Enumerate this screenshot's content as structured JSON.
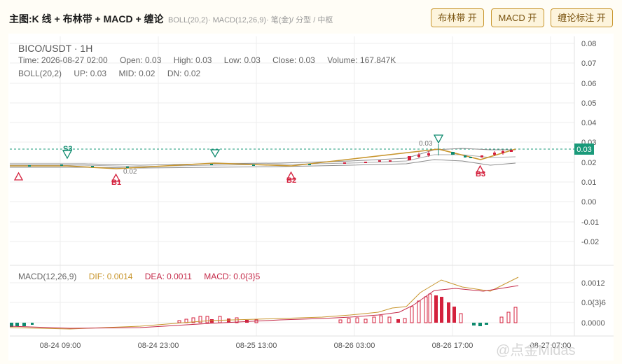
{
  "header": {
    "title": "主图:K 线 + 布林带 + MACD + 缠论",
    "subtitle": "BOLL(20,2)· MACD(12,26,9)· 笔(金)/ 分型 / 中枢",
    "buttons": {
      "boll": "布林带 开",
      "macd": "MACD 开",
      "chan": "缠论标注 开"
    }
  },
  "legend": {
    "symbol": "BICO/USDT · 1H",
    "time": "Time: 2026-08-27 02:00",
    "open": "Open: 0.03",
    "high": "High: 0.03",
    "low": "Low: 0.03",
    "close": "Close: 0.03",
    "volume": "Volume: 167.847K",
    "boll_name": "BOLL(20,2)",
    "boll_up": "UP: 0.03",
    "boll_mid": "MID: 0.02",
    "boll_dn": "DN: 0.02"
  },
  "macd_legend": {
    "name": "MACD(12,26,9)",
    "dif": "DIF: 0.0014",
    "dea": "DEA: 0.0011",
    "macd": "MACD: 0.0{3}5"
  },
  "price_axis": {
    "ticks": [
      "0.08",
      "0.07",
      "0.06",
      "0.05",
      "0.04",
      "0.03",
      "0.02",
      "0.01",
      "0.00",
      "-0.01",
      "-0.02"
    ]
  },
  "macd_axis": {
    "ticks": [
      "0.0012",
      "0.0{3}6",
      "0.0000"
    ]
  },
  "time_axis": {
    "ticks": [
      "08-24 09:00",
      "08-24 23:00",
      "08-25 13:00",
      "08-26 03:00",
      "08-26 17:00",
      "08-27 07:00"
    ]
  },
  "current_price": "0.03",
  "annotations": {
    "s3": "S3",
    "b1": "B1",
    "b2": "B2",
    "b3": "B3",
    "low_label": "0.02",
    "high_label": "0.03"
  },
  "watermark": "@点金Midas",
  "colors": {
    "up": "#d4213d",
    "down": "#0e8a6e",
    "boll_mid": "#c8962e",
    "boll_band": "#8c8c8c",
    "stroke": "#c8962e"
  }
}
